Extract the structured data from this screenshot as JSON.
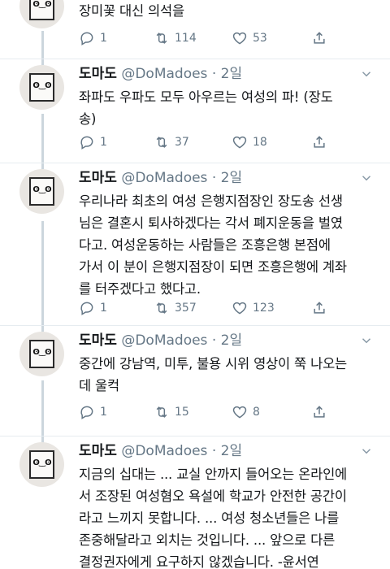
{
  "colors": {
    "muted": "#657786",
    "text": "#14171a",
    "divider": "#e6ecf0",
    "thread": "#ccd6dd"
  },
  "tweets": [
    {
      "text": "장미꽃 대신 의석을",
      "replies": "1",
      "retweets": "114",
      "likes": "53"
    },
    {
      "name": "도마도",
      "handle": "@DoMadoes",
      "dot": "·",
      "time": "2일",
      "text": "좌파도 우파도 모두 아우르는 여성의 파! (장도\n송)",
      "replies": "1",
      "retweets": "37",
      "likes": "18"
    },
    {
      "name": "도마도",
      "handle": "@DoMadoes",
      "dot": "·",
      "time": "2일",
      "text": "우리나라 최초의 여성 은행지점장인 장도송 선생\n님은 결혼시 퇴사하겠다는 각서 폐지운동을 벌였\n다고. 여성운동하는 사람들은 조흥은행 본점에\n가서 이 분이 은행지점장이 되면 조흥은행에 계좌\n를 터주겠다고 했다고.",
      "replies": "1",
      "retweets": "357",
      "likes": "123"
    },
    {
      "name": "도마도",
      "handle": "@DoMadoes",
      "dot": "·",
      "time": "2일",
      "text": "중간에 강남역, 미투, 불용 시위 영상이 쭉 나오는\n데 울컥",
      "replies": "1",
      "retweets": "15",
      "likes": "8"
    },
    {
      "name": "도마도",
      "handle": "@DoMadoes",
      "dot": "·",
      "time": "2일",
      "text": "지금의 십대는 ... 교실 안까지 들어오는 온라인에\n서 조장된 여성혐오 욕설에 학교가 안전한 공간이\n라고 느끼지 못합니다. ... 여성 청소년들은 나를\n존중해달라고 외치는 것입니다. ... 앞으로 다른\n결정권자에게 요구하지 않겠습니다. -윤서연"
    }
  ]
}
